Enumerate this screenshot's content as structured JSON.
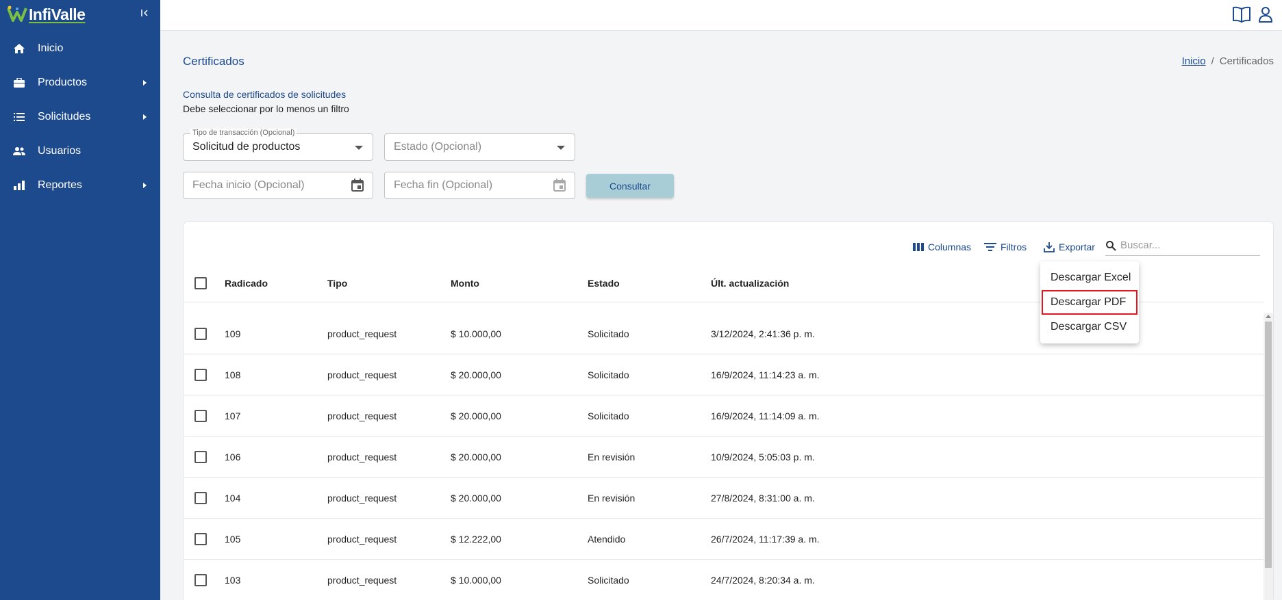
{
  "app": {
    "brand": "InfiValle"
  },
  "sidebar": {
    "items": [
      {
        "label": "Inicio",
        "icon": "home-icon",
        "has_children": false
      },
      {
        "label": "Productos",
        "icon": "briefcase-icon",
        "has_children": true
      },
      {
        "label": "Solicitudes",
        "icon": "list-icon",
        "has_children": true
      },
      {
        "label": "Usuarios",
        "icon": "users-icon",
        "has_children": false
      },
      {
        "label": "Reportes",
        "icon": "chart-icon",
        "has_children": true
      }
    ]
  },
  "header": {
    "icons": [
      "book-icon",
      "user-icon"
    ]
  },
  "page": {
    "title": "Certificados",
    "breadcrumb": {
      "home": "Inicio",
      "separator": "/",
      "current": "Certificados"
    },
    "subtitle": "Consulta de certificados de solicitudes",
    "hint": "Debe seleccionar por lo menos un filtro"
  },
  "filters": {
    "tipo": {
      "label": "Tipo de transacción (Opcional)",
      "value": "Solicitud de productos"
    },
    "estado": {
      "placeholder": "Estado (Opcional)"
    },
    "fecha_inicio": {
      "placeholder": "Fecha inicio (Opcional)"
    },
    "fecha_fin": {
      "placeholder": "Fecha fin (Opcional)"
    },
    "submit_label": "Consultar"
  },
  "table": {
    "toolbar": {
      "columns_label": "Columnas",
      "filters_label": "Filtros",
      "export_label": "Exportar",
      "search_placeholder": "Buscar..."
    },
    "columns": [
      "Radicado",
      "Tipo",
      "Monto",
      "Estado",
      "Últ. actualización"
    ],
    "rows": [
      [
        "109",
        "product_request",
        "$ 10.000,00",
        "Solicitado",
        "3/12/2024, 2:41:36 p. m."
      ],
      [
        "108",
        "product_request",
        "$ 20.000,00",
        "Solicitado",
        "16/9/2024, 11:14:23 a. m."
      ],
      [
        "107",
        "product_request",
        "$ 20.000,00",
        "Solicitado",
        "16/9/2024, 11:14:09 a. m."
      ],
      [
        "106",
        "product_request",
        "$ 20.000,00",
        "En revisión",
        "10/9/2024, 5:05:03 p. m."
      ],
      [
        "104",
        "product_request",
        "$ 20.000,00",
        "En revisión",
        "27/8/2024, 8:31:00 a. m."
      ],
      [
        "105",
        "product_request",
        "$ 12.222,00",
        "Atendido",
        "26/7/2024, 11:17:39 a. m."
      ],
      [
        "103",
        "product_request",
        "$ 10.000,00",
        "Solicitado",
        "24/7/2024, 8:20:34 a. m."
      ]
    ]
  },
  "export_menu": {
    "items": [
      "Descargar Excel",
      "Descargar PDF",
      "Descargar CSV"
    ],
    "highlighted": "Descargar PDF",
    "highlight_color": "#e5161e"
  },
  "colors": {
    "sidebar": "#1c4a8c",
    "accent": "#1c4a8c",
    "button": "#a9cdd6"
  }
}
